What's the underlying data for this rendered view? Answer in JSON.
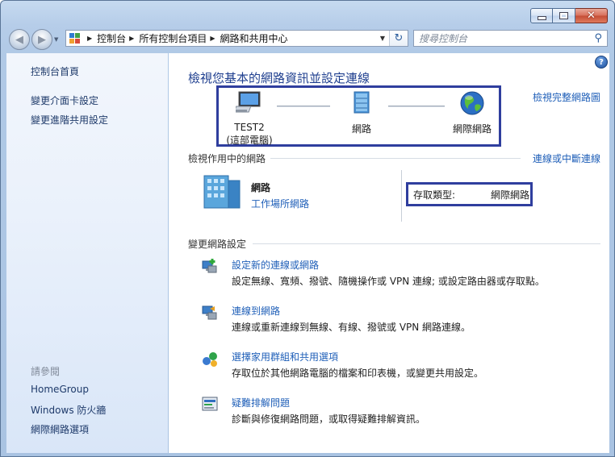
{
  "window": {
    "controls": [
      "minimize",
      "maximize",
      "close"
    ]
  },
  "nav": {
    "breadcrumbs": [
      "控制台",
      "所有控制台項目",
      "網路和共用中心"
    ],
    "search_placeholder": "搜尋控制台"
  },
  "sidebar": {
    "home": "控制台首頁",
    "links": [
      "變更介面卡設定",
      "變更進階共用設定"
    ],
    "see_also_header": "請參閱",
    "see_also": [
      "HomeGroup",
      "Windows 防火牆",
      "網際網路選項"
    ]
  },
  "main": {
    "title": "檢視您基本的網路資訊並設定連線",
    "full_map_link": "檢視完整網路圖",
    "map": {
      "computer_name": "TEST2",
      "computer_sub": "(這部電腦)",
      "network": "網路",
      "internet": "網際網路"
    },
    "active_section": {
      "title": "檢視作用中的網路",
      "link": "連線或中斷連線",
      "network_name": "網路",
      "network_type": "工作場所網路",
      "access_label": "存取類型:",
      "access_value": "網際網路"
    },
    "change_section": {
      "title": "變更網路設定",
      "tasks": [
        {
          "icon": "new-connection-icon",
          "title": "設定新的連線或網路",
          "desc": "設定無線、寬頻、撥號、隨機操作或 VPN 連線; 或設定路由器或存取點。"
        },
        {
          "icon": "connect-network-icon",
          "title": "連線到網路",
          "desc": "連線或重新連線到無線、有線、撥號或 VPN 網路連線。"
        },
        {
          "icon": "homegroup-icon",
          "title": "選擇家用群組和共用選項",
          "desc": "存取位於其他網路電腦的檔案和印表機，或變更共用設定。"
        },
        {
          "icon": "troubleshoot-icon",
          "title": "疑難排解問題",
          "desc": "診斷與修復網路問題，或取得疑難排解資訊。"
        }
      ]
    }
  },
  "colors": {
    "link": "#1f5fb8",
    "title": "#1f3f8f",
    "highlight_box": "#2f3e9e"
  }
}
